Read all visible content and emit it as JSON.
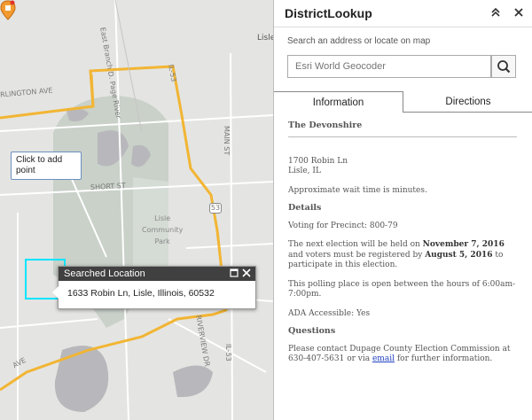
{
  "map": {
    "street_labels": {
      "east_branch": "East Branch D. Page River",
      "lisle_top": "Lisle",
      "arlington": "RLINGTON AVE",
      "il53": "IL-53",
      "main_st": "MAIN ST",
      "short_st": "SHORT ST",
      "park": "Lisle\nCommunity\nPark",
      "rt53": "53",
      "riverview": "RIVERVIEW DR",
      "il53b": "IL-53",
      "ave": "AVE"
    },
    "tooltip_text": "Click to add point",
    "popup": {
      "title": "Searched Location",
      "address": "1633 Robin Ln, Lisle, Illinois, 60532",
      "maximize_icon": "maximize-icon",
      "close_icon": "close-icon"
    },
    "colors": {
      "road": "#f2b533",
      "park": "#c9d1c9",
      "water": "#b8b8bc",
      "selection": "#00e5ff"
    }
  },
  "panel": {
    "title": "DistrictLookup",
    "collapse_icon": "double-chevron-up-icon",
    "close_icon": "close-icon",
    "search_label": "Search an address or locate on map",
    "search_placeholder": "Esri World Geocoder",
    "search_icon": "search-icon",
    "tabs": [
      "Information",
      "Directions"
    ],
    "info": {
      "place_name": "The Devonshire",
      "address_line1": "1700 Robin Ln",
      "address_line2": "Lisle, IL",
      "wait_time": "Approximate wait time is  minutes.",
      "details_heading": "Details",
      "precinct": "Voting for Precinct: 800-79",
      "election_prefix": "The next election will be held on ",
      "election_date": "November 7, 2016",
      "election_mid": " and voters must be registered by ",
      "register_date": "August 5, 2016",
      "election_suffix": " to participate in this election.",
      "hours": "This polling place is open between the hours of 6:00am-7:00pm.",
      "ada": "ADA Accessible: Yes",
      "questions_heading": "Questions",
      "contact_prefix": "Please contact Dupage County Election Commission at 630-407-5631 or via ",
      "contact_link": "email",
      "contact_suffix": " for further information."
    }
  }
}
